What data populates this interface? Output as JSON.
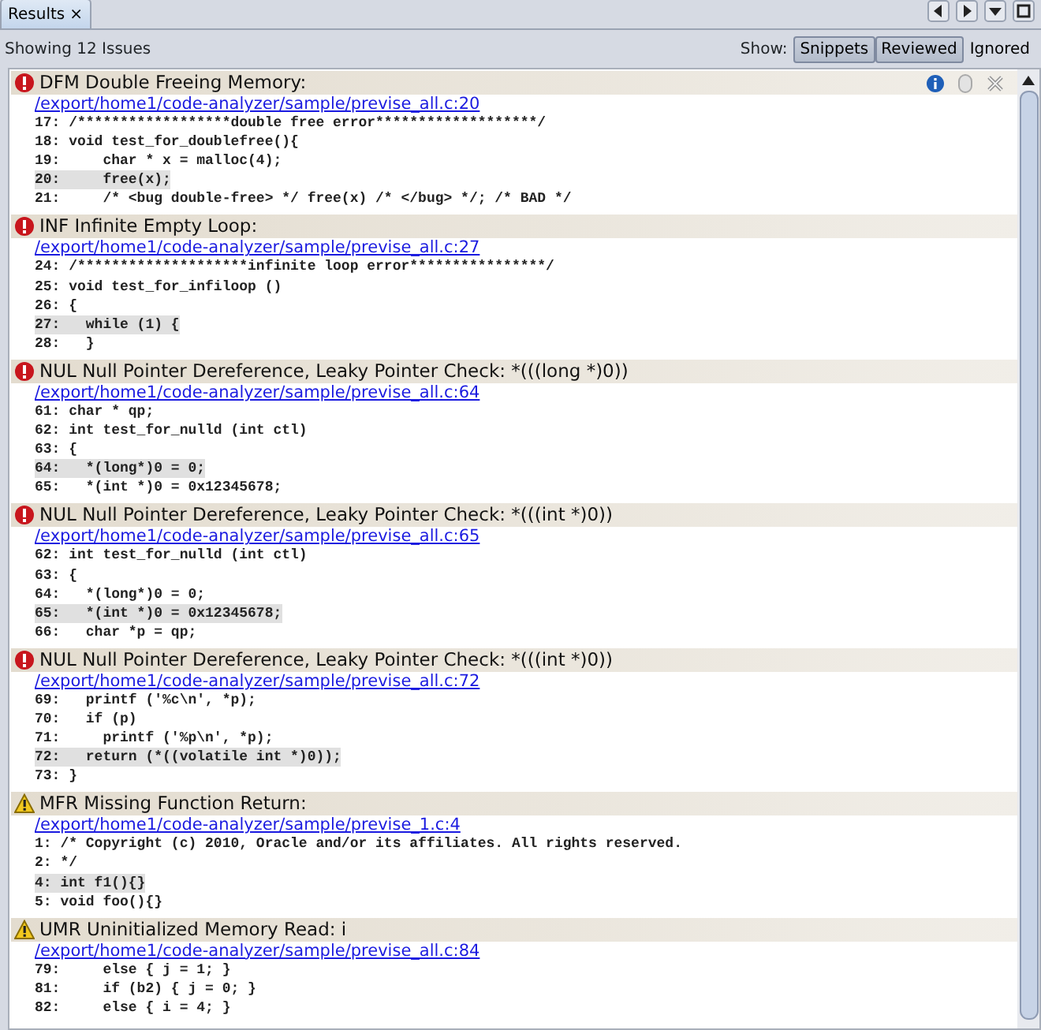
{
  "tab": {
    "label": "Results",
    "close": "×",
    "selected": true
  },
  "summary": "Showing 12 Issues",
  "show_label": "Show:",
  "filters": [
    {
      "label": "Snippets",
      "selected": true
    },
    {
      "label": "Reviewed",
      "selected": true
    },
    {
      "label": "Ignored",
      "selected": false
    }
  ],
  "issues": [
    {
      "kind": "error",
      "title": "DFM Double Freeing Memory:",
      "hovered": true,
      "file": "/export/home1/code-analyzer/sample/previse_all.c:20",
      "lines": [
        {
          "text": "17: /******************double free error*******************/",
          "highlighted": false
        },
        {
          "text": "18: void test_for_doublefree(){",
          "highlighted": false
        },
        {
          "text": "19:     char * x = malloc(4);",
          "highlighted": false
        },
        {
          "text": "20:     free(x);",
          "highlighted": true
        },
        {
          "text": "21:     /* <bug double-free> */ free(x) /* </bug> */; /* BAD */",
          "highlighted": false
        }
      ]
    },
    {
      "kind": "error",
      "title": "INF Infinite Empty Loop:",
      "hovered": false,
      "file": "/export/home1/code-analyzer/sample/previse_all.c:27",
      "lines": [
        {
          "text": "24: /********************infinite loop error****************/",
          "highlighted": false
        },
        {
          "text": "25: void test_for_infiloop ()",
          "highlighted": false
        },
        {
          "text": "26: {",
          "highlighted": false
        },
        {
          "text": "27:   while (1) {",
          "highlighted": true
        },
        {
          "text": "28:   }",
          "highlighted": false
        }
      ]
    },
    {
      "kind": "error",
      "title": "NUL Null Pointer Dereference, Leaky Pointer Check: *(((long *)0))",
      "hovered": false,
      "file": "/export/home1/code-analyzer/sample/previse_all.c:64",
      "lines": [
        {
          "text": "61: char * qp;",
          "highlighted": false
        },
        {
          "text": "62: int test_for_nulld (int ctl)",
          "highlighted": false
        },
        {
          "text": "63: {",
          "highlighted": false
        },
        {
          "text": "64:   *(long*)0 = 0;",
          "highlighted": true
        },
        {
          "text": "65:   *(int *)0 = 0x12345678;",
          "highlighted": false
        }
      ]
    },
    {
      "kind": "error",
      "title": "NUL Null Pointer Dereference, Leaky Pointer Check: *(((int *)0))",
      "hovered": false,
      "file": "/export/home1/code-analyzer/sample/previse_all.c:65",
      "lines": [
        {
          "text": "62: int test_for_nulld (int ctl)",
          "highlighted": false
        },
        {
          "text": "63: {",
          "highlighted": false
        },
        {
          "text": "64:   *(long*)0 = 0;",
          "highlighted": false
        },
        {
          "text": "65:   *(int *)0 = 0x12345678;",
          "highlighted": true
        },
        {
          "text": "66:   char *p = qp;",
          "highlighted": false
        }
      ]
    },
    {
      "kind": "error",
      "title": "NUL Null Pointer Dereference, Leaky Pointer Check: *(((int *)0))",
      "hovered": false,
      "file": "/export/home1/code-analyzer/sample/previse_all.c:72",
      "lines": [
        {
          "text": "69:   printf ('%c\\n', *p);",
          "highlighted": false
        },
        {
          "text": "70:   if (p)",
          "highlighted": false
        },
        {
          "text": "71:     printf ('%p\\n', *p);",
          "highlighted": false
        },
        {
          "text": "72:   return (*((volatile int *)0));",
          "highlighted": true
        },
        {
          "text": "73: }",
          "highlighted": false
        }
      ]
    },
    {
      "kind": "warning",
      "title": "MFR Missing Function Return:",
      "hovered": false,
      "file": "/export/home1/code-analyzer/sample/previse_1.c:4",
      "lines": [
        {
          "text": "1: /* Copyright (c) 2010, Oracle and/or its affiliates. All rights reserved.",
          "highlighted": false
        },
        {
          "text": "2: */",
          "highlighted": false
        },
        {
          "text": "4: int f1(){}",
          "highlighted": true
        },
        {
          "text": "5: void foo(){}",
          "highlighted": false
        }
      ]
    },
    {
      "kind": "warning",
      "title": "UMR Uninitialized Memory Read: i",
      "hovered": false,
      "file": "/export/home1/code-analyzer/sample/previse_all.c:84",
      "lines": [
        {
          "text": "79:     else { j = 1; }",
          "highlighted": false
        },
        {
          "text": "81:     if (b2) { j = 0; }",
          "highlighted": false
        },
        {
          "text": "82:     else { i = 4; }",
          "highlighted": false
        }
      ]
    }
  ]
}
